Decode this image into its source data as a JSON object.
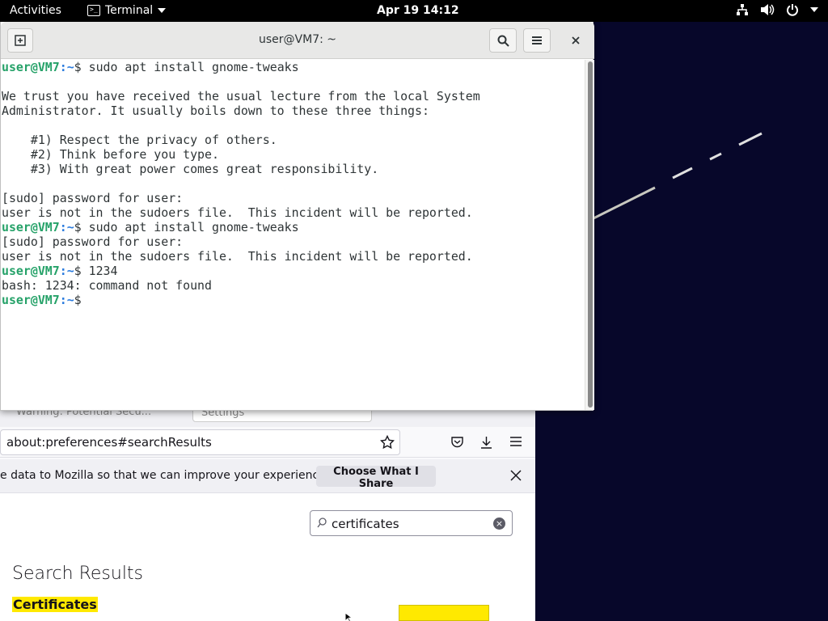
{
  "topbar": {
    "activities": "Activities",
    "app_name": "Terminal",
    "clock": "Apr 19  14:12",
    "tray_icons": [
      "network-icon",
      "volume-icon",
      "power-icon",
      "chevron-down-icon"
    ]
  },
  "terminal": {
    "title": "user@VM7: ~",
    "buttons": [
      "new-tab-icon",
      "search-icon",
      "hamburger-menu-icon",
      "close-icon"
    ],
    "prompt_user": "user@VM7",
    "prompt_path": ":~",
    "lines": [
      {
        "type": "prompt",
        "cmd": "$ sudo apt install gnome-tweaks"
      },
      {
        "type": "text",
        "text": ""
      },
      {
        "type": "text",
        "text": "We trust you have received the usual lecture from the local System"
      },
      {
        "type": "text",
        "text": "Administrator. It usually boils down to these three things:"
      },
      {
        "type": "text",
        "text": ""
      },
      {
        "type": "text",
        "text": "    #1) Respect the privacy of others."
      },
      {
        "type": "text",
        "text": "    #2) Think before you type."
      },
      {
        "type": "text",
        "text": "    #3) With great power comes great responsibility."
      },
      {
        "type": "text",
        "text": ""
      },
      {
        "type": "text",
        "text": "[sudo] password for user:"
      },
      {
        "type": "text",
        "text": "user is not in the sudoers file.  This incident will be reported."
      },
      {
        "type": "prompt",
        "cmd": "$ sudo apt install gnome-tweaks"
      },
      {
        "type": "text",
        "text": "[sudo] password for user:"
      },
      {
        "type": "text",
        "text": "user is not in the sudoers file.  This incident will be reported."
      },
      {
        "type": "prompt",
        "cmd": "$ 1234"
      },
      {
        "type": "text",
        "text": "bash: 1234: command not found"
      },
      {
        "type": "prompt",
        "cmd": "$"
      }
    ]
  },
  "firefox": {
    "tab1_label": "Warning: Potential Secu...",
    "tab2_label": "Settings",
    "url": "about:preferences#searchResults",
    "notification_text": "e data to Mozilla so that we can improve your experience.",
    "choose_button": "Choose What I Share",
    "search_value": "certificates",
    "results_title": "Search Results",
    "cert_heading": "Certificates",
    "toolbar_icons": [
      "star-icon",
      "pocket-icon",
      "download-icon",
      "menu-icon"
    ],
    "highlight_color": "#ffe900"
  }
}
